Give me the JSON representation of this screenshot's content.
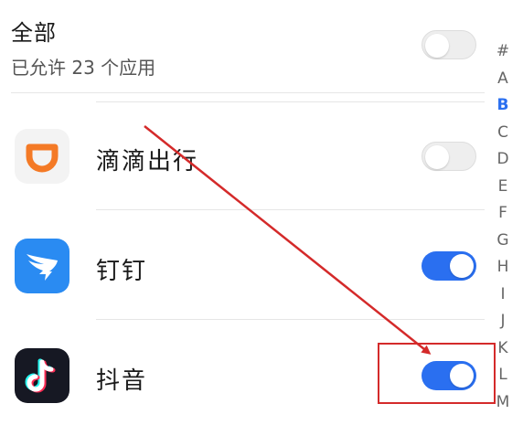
{
  "all_row": {
    "title": "全部",
    "subtitle": "已允许 23 个应用",
    "toggle_on": false
  },
  "apps": [
    {
      "name": "滴滴出行",
      "icon": "didi-icon",
      "toggle_on": false
    },
    {
      "name": "钉钉",
      "icon": "dingtalk-icon",
      "toggle_on": true
    },
    {
      "name": "抖音",
      "icon": "douyin-icon",
      "toggle_on": true
    }
  ],
  "index": {
    "letters": [
      "#",
      "A",
      "B",
      "C",
      "D",
      "E",
      "F",
      "G",
      "H",
      "I",
      "J",
      "K",
      "L",
      "M"
    ],
    "active": "B"
  },
  "colors": {
    "accent": "#2a6ff0",
    "annotation": "#d42a2a",
    "didi_orange": "#f47a26",
    "dingtalk_blue": "#2a8bf2",
    "douyin_bg": "#161823"
  }
}
